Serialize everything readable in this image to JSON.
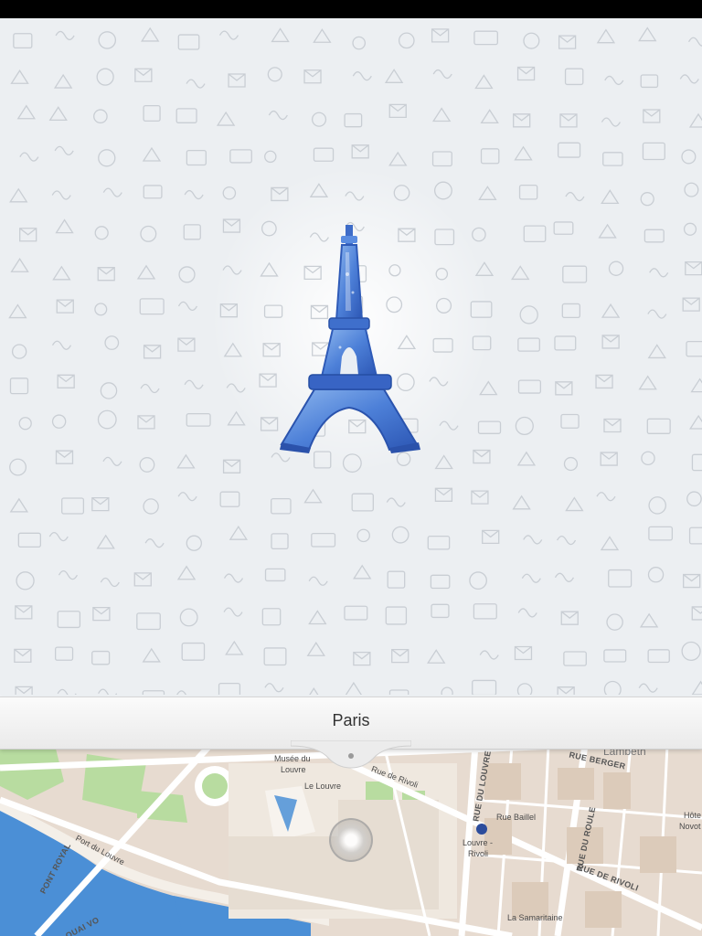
{
  "place": {
    "title": "Paris"
  },
  "map_labels": {
    "musee": "Musée du",
    "louvre": "Louvre",
    "le_louvre": "Le Louvre",
    "rue_de_rivoli_top": "Rue de Rivoli",
    "rue_du_louvre": "RUE DU LOUVRE",
    "rue_berger": "RUE BERGER",
    "lambeth": "Lambeth",
    "rue_bailleul": "Rue Baillel",
    "louvre_rivoli_1": "Louvre -",
    "louvre_rivoli_2": "Rivoli",
    "rue_du_roule": "RUE DU ROULE",
    "rue_de_rivoli": "RUE DE RIVOLI",
    "port_du_louvre": "Port du Louvre",
    "pont_royal": "PONT ROYAL",
    "quai_vo": "QUAI VO",
    "la_samaritaine": "La Samaritaine",
    "hotel_1": "Hôte",
    "hotel_2": "Novot"
  },
  "colors": {
    "tower": "#3c6fcf",
    "water": "#4b8fd6",
    "park": "#b8dca0",
    "road": "#ffffff"
  }
}
